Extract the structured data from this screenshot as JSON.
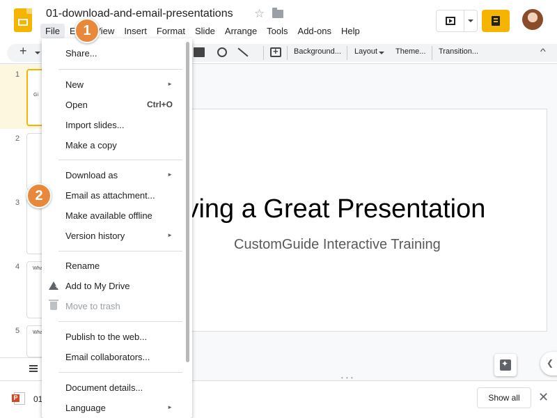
{
  "app": {
    "doc_title": "01-download-and-email-presentations"
  },
  "menubar": [
    "File",
    "Edit",
    "View",
    "Insert",
    "Format",
    "Slide",
    "Arrange",
    "Tools",
    "Add-ons",
    "Help"
  ],
  "toolbar": {
    "background_label": "Background...",
    "layout_label": "Layout",
    "theme_label": "Theme...",
    "transition_label": "Transition..."
  },
  "filmstrip": {
    "slides": [
      {
        "num": "1",
        "thumb_text": "Gi"
      },
      {
        "num": "2",
        "thumb_text": ""
      },
      {
        "num": "3",
        "thumb_text": ""
      },
      {
        "num": "4",
        "thumb_text": "Wha"
      },
      {
        "num": "5",
        "thumb_text": "Wha"
      }
    ]
  },
  "slide": {
    "title": "iving a Great Presentation",
    "subtitle": "CustomGuide Interactive Training"
  },
  "file_menu": {
    "items": [
      {
        "label": "Share...",
        "shortcut": "",
        "submenu": false,
        "disabled": false
      },
      {
        "label": "New",
        "shortcut": "",
        "submenu": true,
        "disabled": false
      },
      {
        "label": "Open",
        "shortcut": "Ctrl+O",
        "submenu": false,
        "disabled": false
      },
      {
        "label": "Import slides...",
        "shortcut": "",
        "submenu": false,
        "disabled": false
      },
      {
        "label": "Make a copy",
        "shortcut": "",
        "submenu": false,
        "disabled": false
      },
      {
        "label": "Download as",
        "shortcut": "",
        "submenu": true,
        "disabled": false
      },
      {
        "label": "Email as attachment...",
        "shortcut": "",
        "submenu": false,
        "disabled": false
      },
      {
        "label": "Make available offline",
        "shortcut": "",
        "submenu": false,
        "disabled": false
      },
      {
        "label": "Version history",
        "shortcut": "",
        "submenu": true,
        "disabled": false
      },
      {
        "label": "Rename",
        "shortcut": "",
        "submenu": false,
        "disabled": false
      },
      {
        "label": "Add to My Drive",
        "shortcut": "",
        "submenu": false,
        "disabled": false
      },
      {
        "label": "Move to trash",
        "shortcut": "",
        "submenu": false,
        "disabled": true
      },
      {
        "label": "Publish to the web...",
        "shortcut": "",
        "submenu": false,
        "disabled": false
      },
      {
        "label": "Email collaborators...",
        "shortcut": "",
        "submenu": false,
        "disabled": false
      },
      {
        "label": "Document details...",
        "shortcut": "",
        "submenu": false,
        "disabled": false
      },
      {
        "label": "Language",
        "shortcut": "",
        "submenu": true,
        "disabled": false
      }
    ],
    "submenu_arrow": "►"
  },
  "download_bar": {
    "file_name": "01",
    "show_all_label": "Show all",
    "close_glyph": "✕"
  },
  "badges": [
    "1",
    "2"
  ],
  "icons": {
    "star": "☆",
    "plus": "+",
    "collapse": "^",
    "side_toggle": "❮",
    "resize": "• • •"
  },
  "colors": {
    "accent": "#f4b400",
    "badge": "#e8883a"
  }
}
